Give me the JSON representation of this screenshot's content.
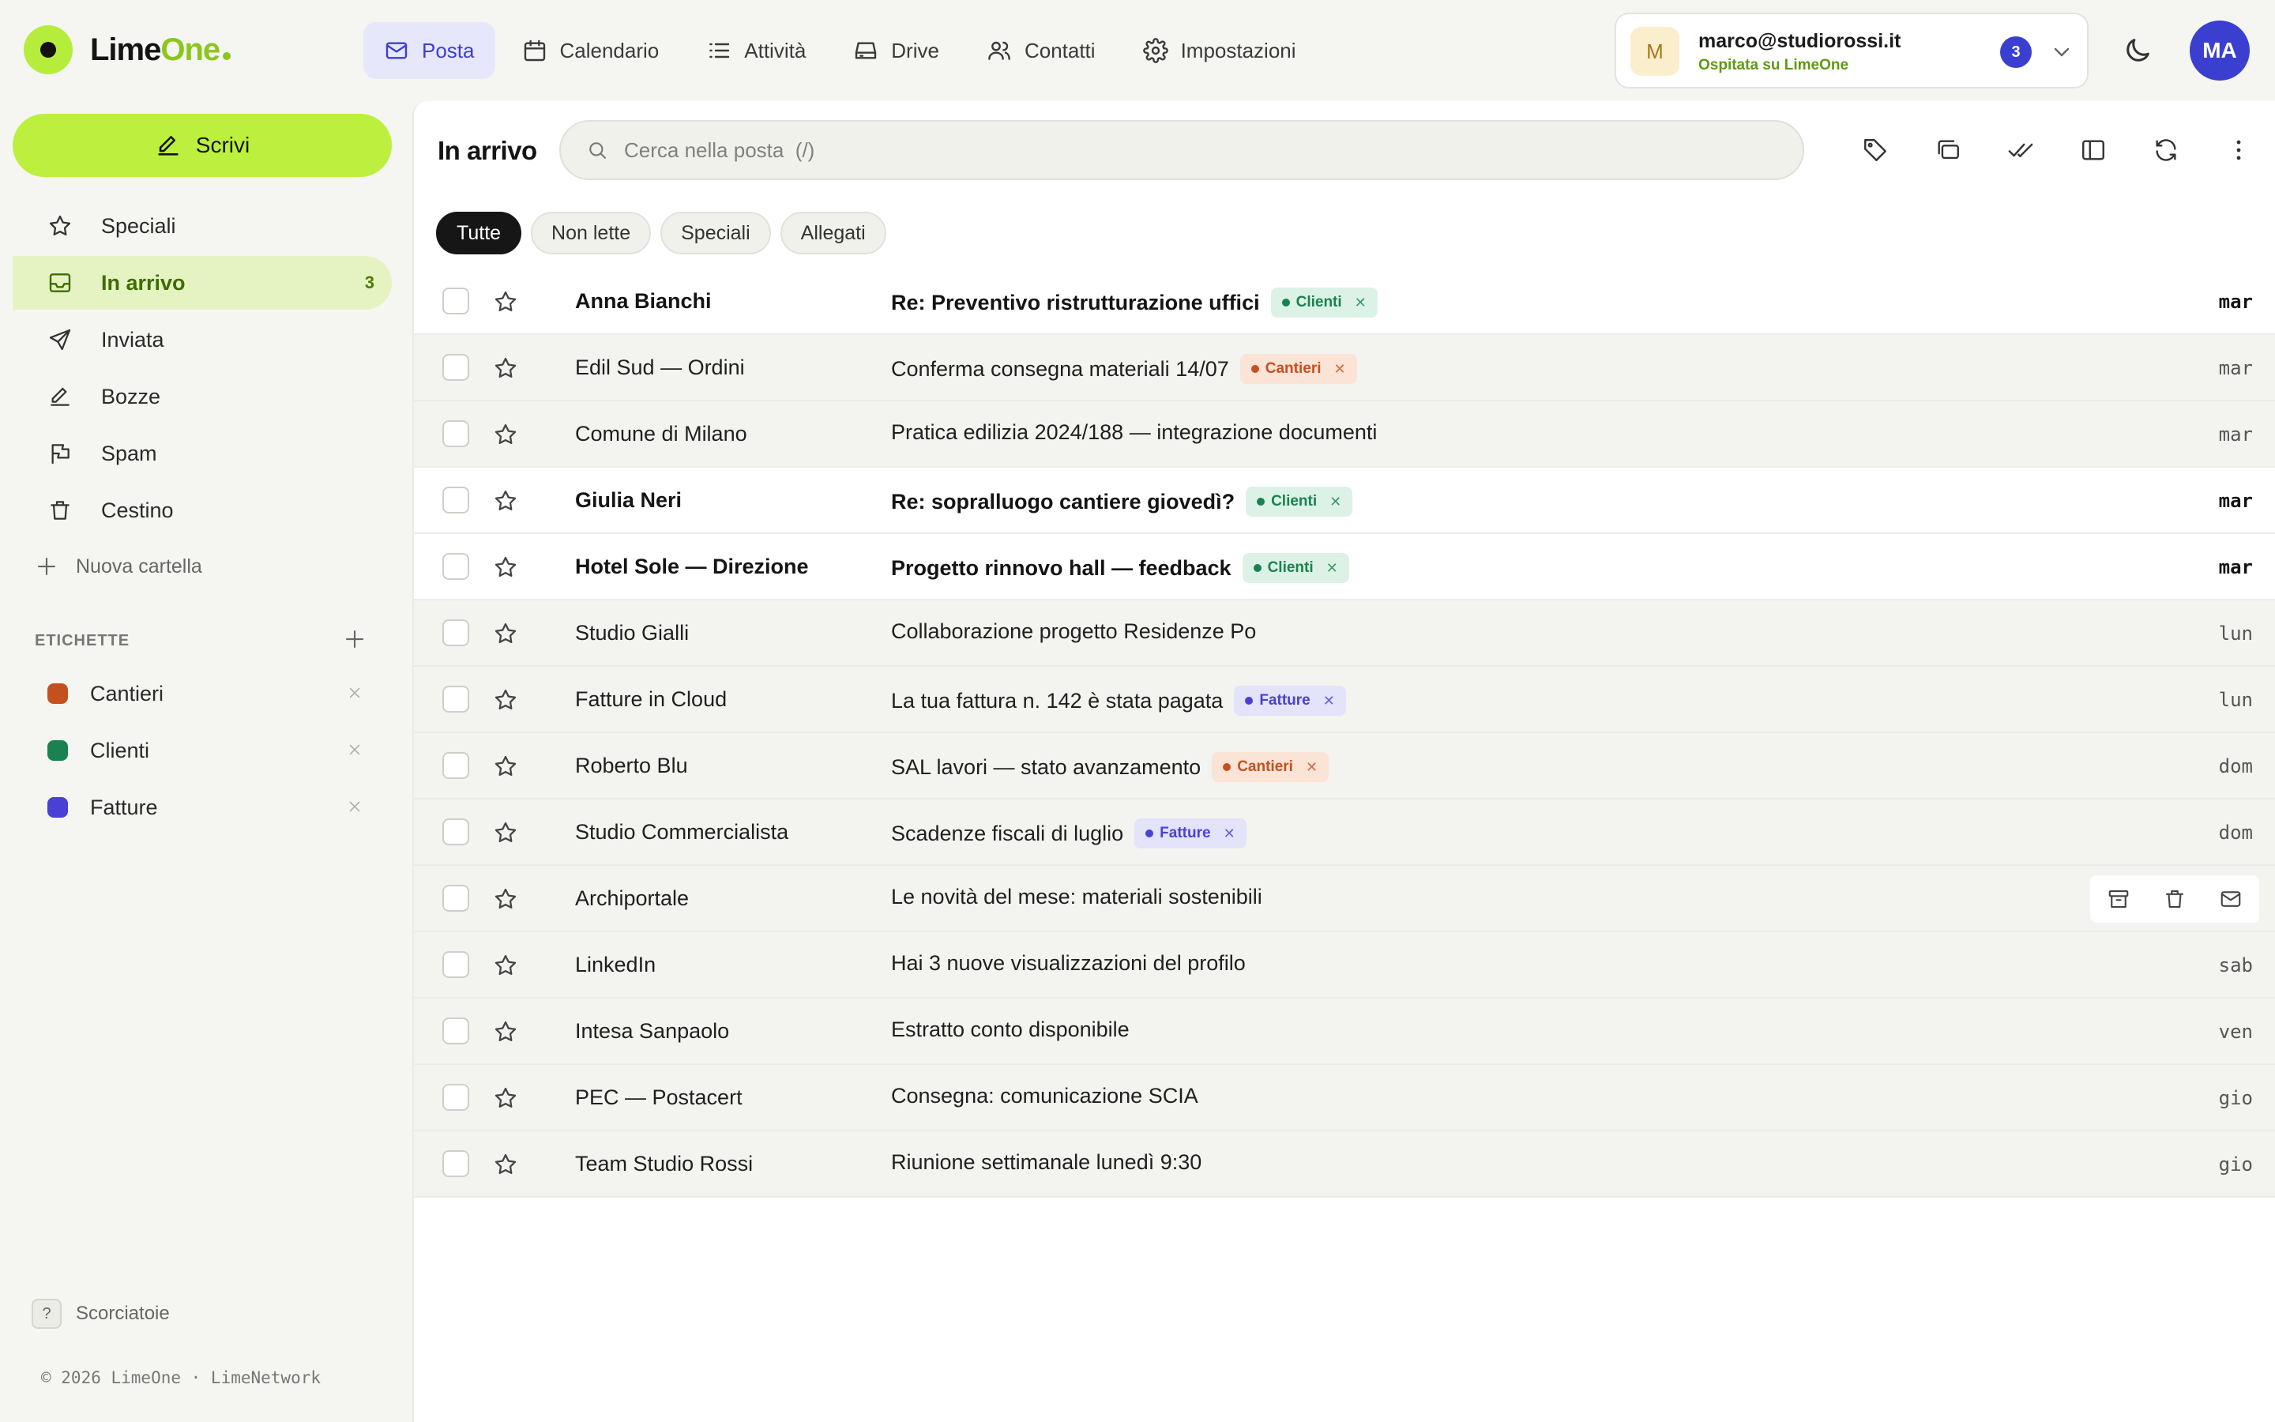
{
  "brand": {
    "name_part1": "Lime",
    "name_part2": "One"
  },
  "nav": [
    {
      "label": "Posta",
      "icon": "mail-icon",
      "active": true
    },
    {
      "label": "Calendario",
      "icon": "calendar-icon"
    },
    {
      "label": "Attività",
      "icon": "list-icon"
    },
    {
      "label": "Drive",
      "icon": "drive-icon"
    },
    {
      "label": "Contatti",
      "icon": "contacts-icon"
    },
    {
      "label": "Impostazioni",
      "icon": "gear-icon"
    }
  ],
  "account": {
    "initial": "M",
    "email": "marco@studiorossi.it",
    "host": "Ospitata su LimeOne",
    "badge": "3"
  },
  "user": {
    "initials": "MA"
  },
  "compose": {
    "label": "Scrivi"
  },
  "folders": [
    {
      "label": "Speciali",
      "icon": "star-icon"
    },
    {
      "label": "In arrivo",
      "icon": "inbox-icon",
      "active": true,
      "count": "3"
    },
    {
      "label": "Inviata",
      "icon": "send-icon"
    },
    {
      "label": "Bozze",
      "icon": "pencil-icon"
    },
    {
      "label": "Spam",
      "icon": "flag-icon"
    },
    {
      "label": "Cestino",
      "icon": "trash-icon"
    }
  ],
  "new_folder": "Nuova cartella",
  "labels_heading": "ETICHETTE",
  "labels": [
    {
      "name": "Cantieri",
      "color": "#c4511d"
    },
    {
      "name": "Clienti",
      "color": "#19824e"
    },
    {
      "name": "Fatture",
      "color": "#4a40d6"
    }
  ],
  "shortcuts": {
    "key": "?",
    "label": "Scorciatoie"
  },
  "copyright": "© 2026 LimeOne · LimeNetwork",
  "inbox": {
    "title": "In arrivo",
    "search_placeholder": "Cerca nella posta  (/)",
    "toolbar": [
      "tag-icon",
      "copy-icon",
      "check-all-icon",
      "panel-icon",
      "refresh-icon",
      "more-vertical-icon"
    ],
    "filters": [
      {
        "label": "Tutte",
        "active": true
      },
      {
        "label": "Non lette"
      },
      {
        "label": "Speciali"
      },
      {
        "label": "Allegati"
      }
    ]
  },
  "messages": [
    {
      "sender": "Anna Bianchi",
      "subject": "Re: Preventivo ristrutturazione uffici",
      "tag": "Clienti",
      "tag_color": "green",
      "date": "mar",
      "unread": true
    },
    {
      "sender": "Edil Sud — Ordini",
      "subject": "Conferma consegna materiali 14/07",
      "tag": "Cantieri",
      "tag_color": "orange",
      "date": "mar",
      "unread": false
    },
    {
      "sender": "Comune di Milano",
      "subject": "Pratica edilizia 2024/188 — integrazione documenti",
      "tag": "",
      "tag_color": "",
      "date": "mar",
      "unread": false
    },
    {
      "sender": "Giulia Neri",
      "subject": "Re: sopralluogo cantiere giovedì?",
      "tag": "Clienti",
      "tag_color": "green",
      "date": "mar",
      "unread": true
    },
    {
      "sender": "Hotel Sole — Direzione",
      "subject": "Progetto rinnovo hall — feedback",
      "tag": "Clienti",
      "tag_color": "green",
      "date": "mar",
      "unread": true
    },
    {
      "sender": "Studio Gialli",
      "subject": "Collaborazione progetto Residenze Po",
      "tag": "",
      "tag_color": "",
      "date": "lun",
      "unread": false
    },
    {
      "sender": "Fatture in Cloud",
      "subject": "La tua fattura n. 142 è stata pagata",
      "tag": "Fatture",
      "tag_color": "purple",
      "date": "lun",
      "unread": false
    },
    {
      "sender": "Roberto Blu",
      "subject": "SAL lavori — stato avanzamento",
      "tag": "Cantieri",
      "tag_color": "orange",
      "date": "dom",
      "unread": false
    },
    {
      "sender": "Studio Commercialista",
      "subject": "Scadenze fiscali di luglio",
      "tag": "Fatture",
      "tag_color": "purple",
      "date": "dom",
      "unread": false
    },
    {
      "sender": "Archiportale",
      "subject": "Le novità del mese: materiali sostenibili",
      "tag": "",
      "tag_color": "",
      "date": "",
      "unread": false,
      "hovered": true
    },
    {
      "sender": "LinkedIn",
      "subject": "Hai 3 nuove visualizzazioni del profilo",
      "tag": "",
      "tag_color": "",
      "date": "sab",
      "unread": false
    },
    {
      "sender": "Intesa Sanpaolo",
      "subject": "Estratto conto disponibile",
      "tag": "",
      "tag_color": "",
      "date": "ven",
      "unread": false
    },
    {
      "sender": "PEC — Postacert",
      "subject": "Consegna: comunicazione SCIA",
      "tag": "",
      "tag_color": "",
      "date": "gio",
      "unread": false
    },
    {
      "sender": "Team Studio Rossi",
      "subject": "Riunione settimanale lunedì 9:30",
      "tag": "",
      "tag_color": "",
      "date": "gio",
      "unread": false
    }
  ],
  "colors": {
    "accent": "#bdf03e",
    "brand_blue": "#3b3fd0",
    "active_folder_bg": "#e5f3c3"
  }
}
